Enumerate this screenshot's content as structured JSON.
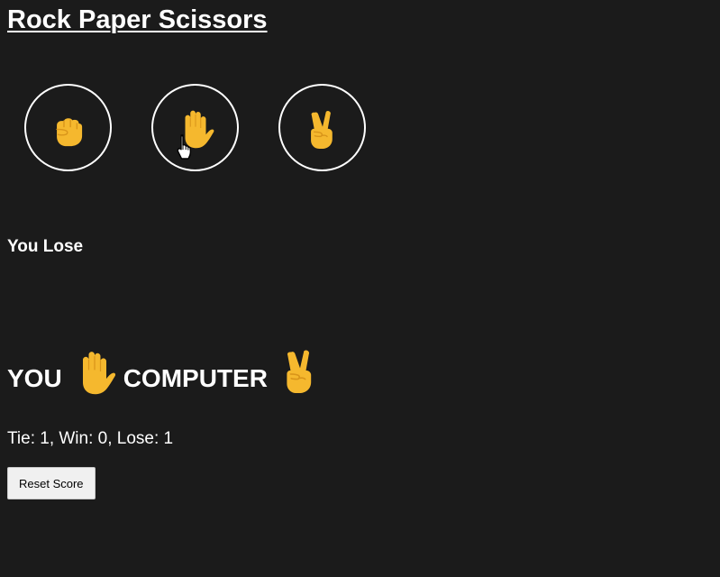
{
  "page": {
    "title": "Rock Paper Scissors"
  },
  "choices": [
    {
      "name": "rock",
      "icon": "fist-icon"
    },
    {
      "name": "paper",
      "icon": "raised-hand-icon"
    },
    {
      "name": "scissors",
      "icon": "victory-hand-icon"
    }
  ],
  "result": {
    "text": "You Lose"
  },
  "moves": {
    "you_label": "YOU",
    "you_icon": "raised-hand-icon",
    "computer_label": "COMPUTER",
    "computer_icon": "victory-hand-icon"
  },
  "score": {
    "text": "Tie: 1, Win: 0, Lose: 1"
  },
  "reset_button": {
    "label": "Reset Score"
  },
  "colors": {
    "background": "#1b1b1b",
    "text": "#ffffff",
    "emoji_yellow": "#f5b82e",
    "emoji_shade": "#d9951a"
  }
}
